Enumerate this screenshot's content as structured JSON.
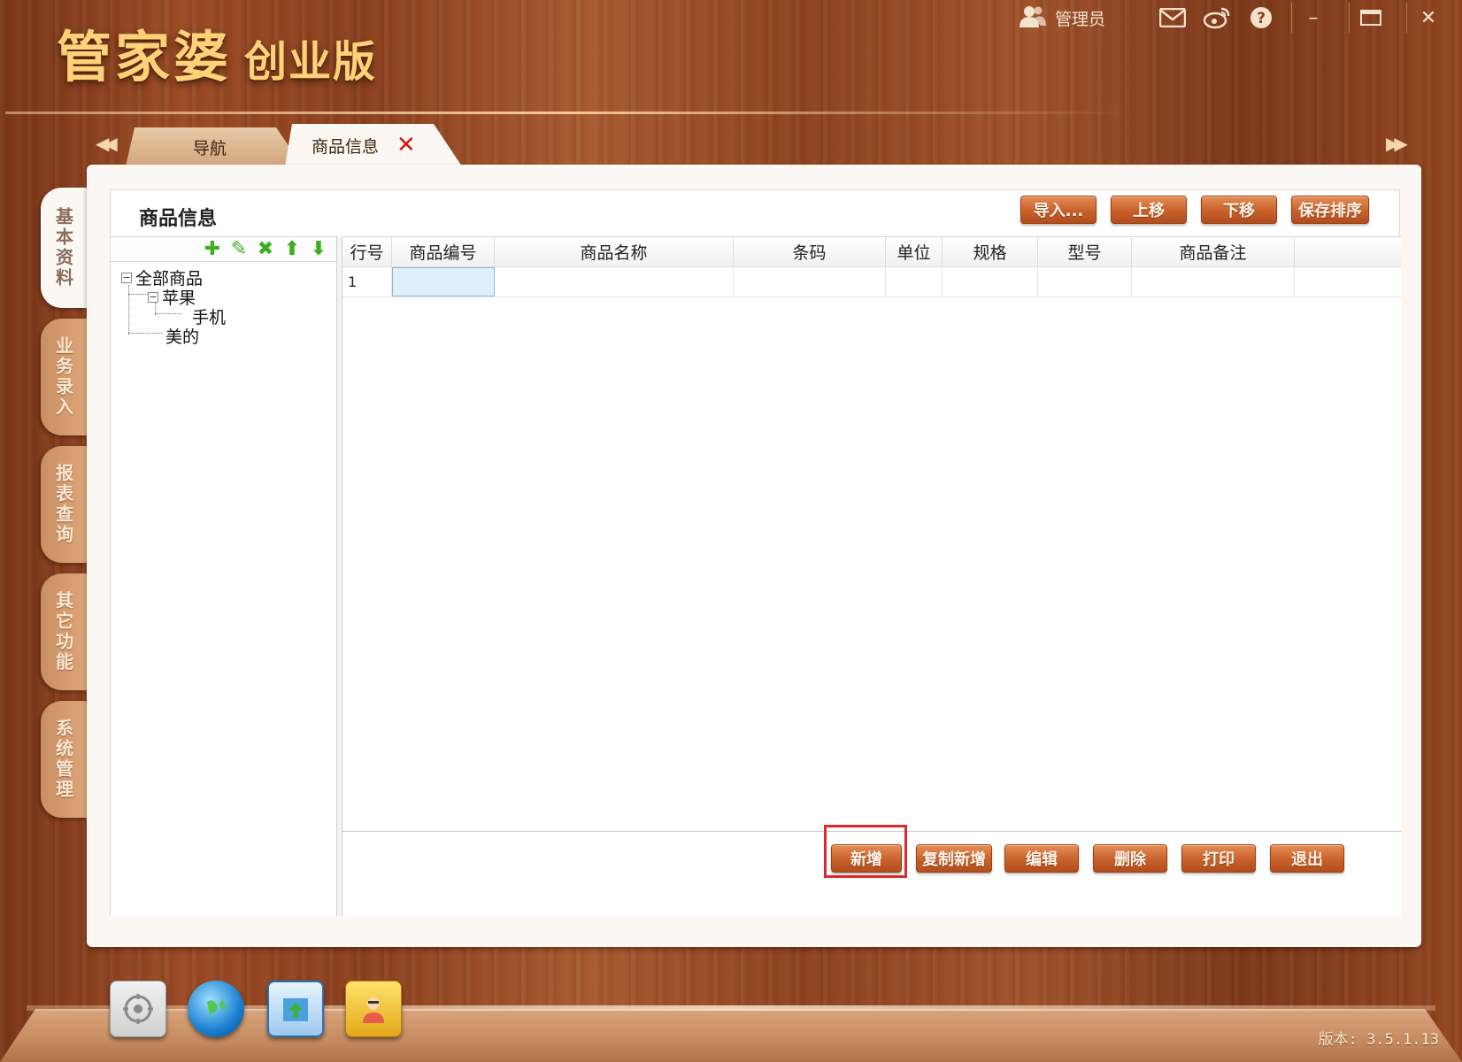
{
  "app": {
    "logo_main": "管家婆",
    "logo_sub": "创业版",
    "version": "版本: 3.5.1.13"
  },
  "topbar": {
    "user_label": "管理员",
    "icons": [
      "user-icon",
      "mail-icon",
      "weibo-icon",
      "help-icon"
    ],
    "window_controls": [
      "minimize",
      "maximize",
      "close"
    ]
  },
  "tabs": [
    {
      "label": "导航",
      "active": false
    },
    {
      "label": "商品信息",
      "active": true,
      "closable": true
    }
  ],
  "side_tabs": [
    {
      "label": "基本资料",
      "active": true
    },
    {
      "label": "业务录入",
      "active": false
    },
    {
      "label": "报表查询",
      "active": false
    },
    {
      "label": "其它功能",
      "active": false
    },
    {
      "label": "系统管理",
      "active": false
    }
  ],
  "page": {
    "title": "商品信息",
    "top_buttons": [
      "导入...",
      "上移",
      "下移",
      "保存排序"
    ]
  },
  "tree": {
    "tools": [
      "add-icon",
      "edit-icon",
      "delete-icon",
      "move-up-icon",
      "move-down-icon"
    ],
    "nodes": [
      {
        "label": "全部商品",
        "level": 0,
        "expander": "⊟"
      },
      {
        "label": "苹果",
        "level": 1,
        "expander": "⊟"
      },
      {
        "label": "手机",
        "level": 2
      },
      {
        "label": "美的",
        "level": 1
      }
    ]
  },
  "grid": {
    "columns": [
      "行号",
      "商品编号",
      "商品名称",
      "条码",
      "单位",
      "规格",
      "型号",
      "商品备注"
    ],
    "rows": [
      [
        "1",
        "",
        "",
        "",
        "",
        "",
        "",
        ""
      ]
    ]
  },
  "bottom_buttons": [
    "新增",
    "复制新增",
    "编辑",
    "删除",
    "打印",
    "退出"
  ],
  "highlighted_button": "新增",
  "colors": {
    "accent_orange": "#c8612b",
    "highlight_red": "#e0282a",
    "tool_green": "#3dae1f"
  }
}
